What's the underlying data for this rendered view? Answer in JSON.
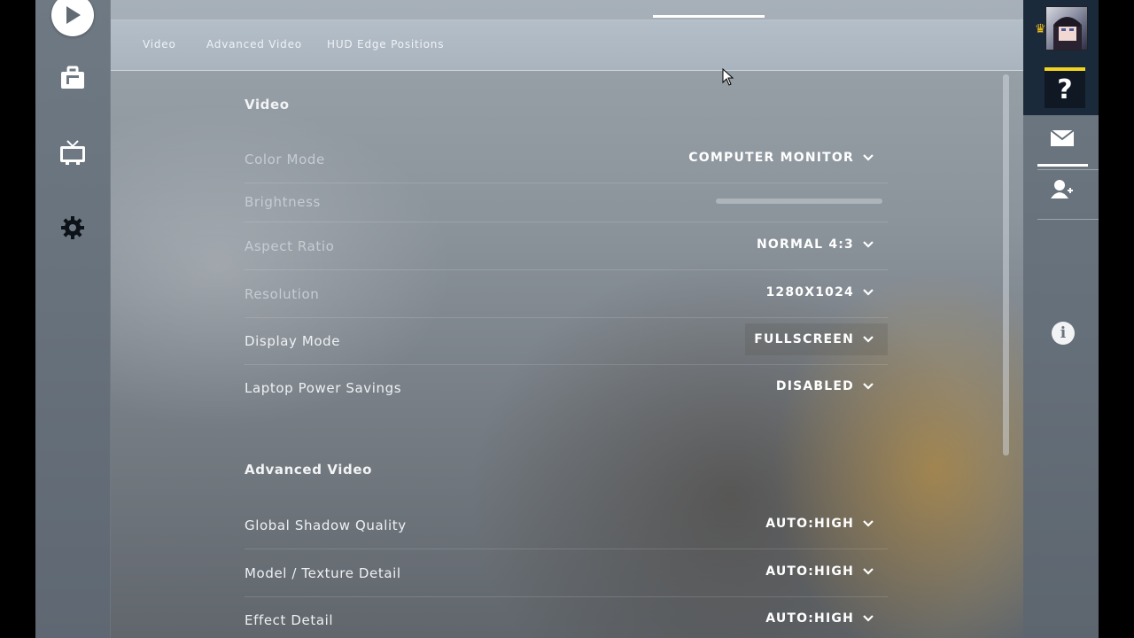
{
  "left_rail": {
    "icons": [
      "play-icon",
      "inventory-icon",
      "tv-icon",
      "gear-icon"
    ]
  },
  "subnav": {
    "items": [
      "Video",
      "Advanced Video",
      "HUD Edge Positions"
    ]
  },
  "video_section": {
    "title": "Video",
    "rows": [
      {
        "label": "Color Mode",
        "value": "COMPUTER MONITOR"
      },
      {
        "label": "Brightness",
        "value": ""
      },
      {
        "label": "Aspect Ratio",
        "value": "NORMAL 4:3"
      },
      {
        "label": "Resolution",
        "value": "1280X1024"
      },
      {
        "label": "Display Mode",
        "value": "FULLSCREEN"
      },
      {
        "label": "Laptop Power Savings",
        "value": "DISABLED"
      }
    ]
  },
  "advanced_section": {
    "title": "Advanced Video",
    "rows": [
      {
        "label": "Global Shadow Quality",
        "value": "AUTO:HIGH"
      },
      {
        "label": "Model / Texture Detail",
        "value": "AUTO:HIGH"
      },
      {
        "label": "Effect Detail",
        "value": "AUTO:HIGH"
      }
    ]
  },
  "right_rail": {
    "help_label": "?",
    "info_label": "i",
    "icons": [
      "avatar",
      "crown-icon",
      "help-icon",
      "mail-icon",
      "add-friend-icon",
      "info-icon"
    ]
  },
  "colors": {
    "accent_yellow": "#f1d320",
    "right_rail_dark": "#1b2a3a"
  }
}
